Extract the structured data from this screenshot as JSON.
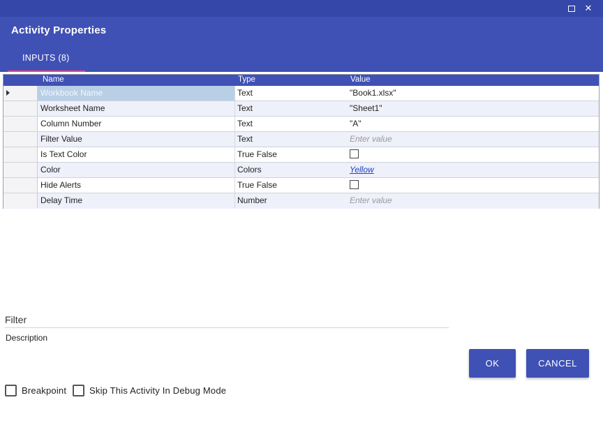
{
  "window": {
    "maximize_icon": "maximize-icon",
    "close_glyph": "✕"
  },
  "header": {
    "title": "Activity Properties",
    "tab_label": "INPUTS (8)",
    "accent_color": "#3f51b5",
    "tab_indicator_color": "#ff4081"
  },
  "grid": {
    "columns": [
      "Name",
      "Type",
      "Value"
    ],
    "rows": [
      {
        "name": "Workbook Name",
        "type": "Text",
        "value": "\"Book1.xlsx\""
      },
      {
        "name": "Worksheet Name",
        "type": "Text",
        "value": "\"Sheet1\""
      },
      {
        "name": "Column Number",
        "type": "Text",
        "value": "\"A\""
      },
      {
        "name": "Filter Value",
        "type": "Text",
        "placeholder": "Enter value"
      },
      {
        "name": "Is Text Color",
        "type": "True False",
        "checked": false
      },
      {
        "name": "Color",
        "type": "Colors",
        "link": "Yellow"
      },
      {
        "name": "Hide Alerts",
        "type": "True False",
        "checked": false
      },
      {
        "name": "Delay Time",
        "type": "Number",
        "placeholder": "Enter value"
      }
    ]
  },
  "footer": {
    "filter_label": "Filter",
    "description_label": "Description",
    "ok_label": "OK",
    "cancel_label": "CANCEL",
    "breakpoint_label": "Breakpoint",
    "skip_label": "Skip This Activity In Debug Mode"
  }
}
